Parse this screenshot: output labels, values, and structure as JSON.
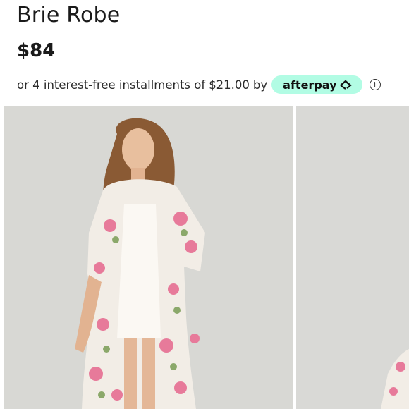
{
  "product": {
    "title": "Brie Robe",
    "price": "$84"
  },
  "payment": {
    "prefix": "or 4 interest-free installments of",
    "amount": "$21.00",
    "by": "by",
    "provider": "afterpay",
    "provider_color": "#b2fce4",
    "info_icon": "info-icon"
  },
  "gallery": {
    "images": [
      {
        "name": "model-front-photo"
      },
      {
        "name": "model-partial-photo"
      }
    ]
  }
}
